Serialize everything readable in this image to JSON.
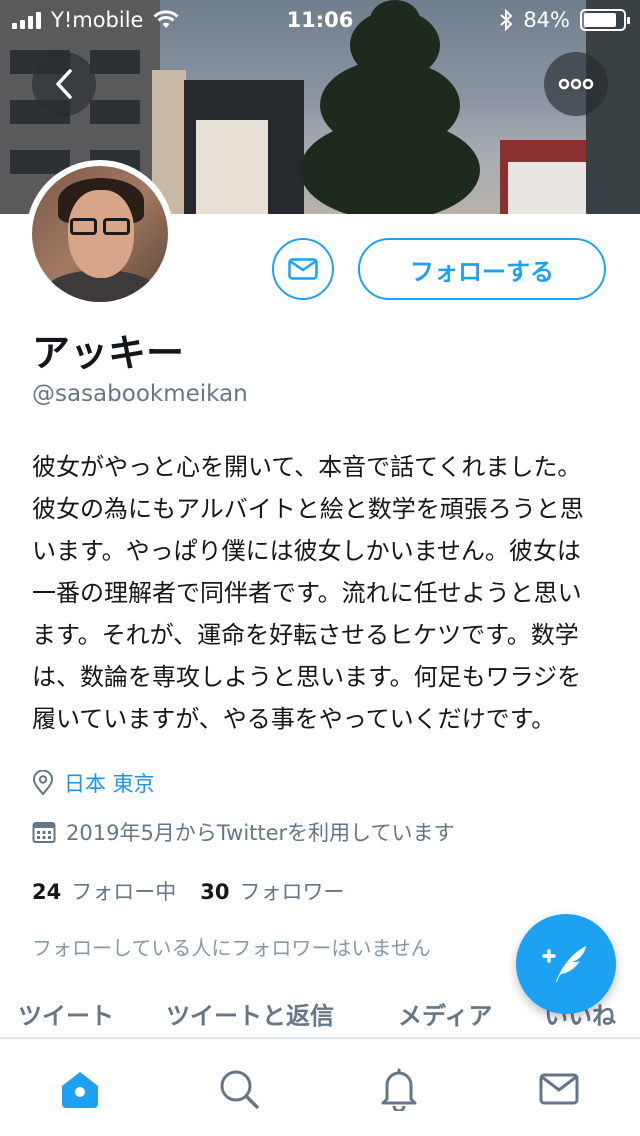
{
  "status_bar": {
    "carrier": "Y!mobile",
    "time": "11:06",
    "battery": "84%",
    "battery_level": 0.84
  },
  "profile": {
    "name": "アッキー",
    "handle": "@sasabookmeikan",
    "bio": "彼女がやっと心を開いて、本音で話てくれました。彼女の為にもアルバイトと絵と数学を頑張ろうと思います。やっぱり僕には彼女しかいません。彼女は一番の理解者で同伴者です。流れに任せようと思います。それが、運命を好転させるヒケツです。数学は、数論を専攻しようと思います。何足もワラジを履いていますが、やる事をやっていくだけです。",
    "location": "日本 東京",
    "joined": "2019年5月からTwitterを利用しています",
    "following_count": "24",
    "following_label": "フォロー中",
    "followers_count": "30",
    "followers_label": "フォロワー",
    "mutual_note": "フォローしている人にフォロワーはいません"
  },
  "actions": {
    "follow_label": "フォローする"
  },
  "tabs": [
    {
      "label": "ツイート",
      "active": true
    },
    {
      "label": "ツイートと返信",
      "active": false
    },
    {
      "label": "メディア",
      "active": false
    },
    {
      "label": "いいね",
      "active": false
    }
  ],
  "icons": {
    "back": "back-arrow-icon",
    "more": "more-options-icon",
    "message": "envelope-icon",
    "location": "location-pin-icon",
    "calendar": "calendar-icon",
    "compose": "compose-tweet-icon",
    "nav": [
      "home-icon",
      "search-icon",
      "notifications-icon",
      "messages-icon"
    ]
  },
  "colors": {
    "accent": "#1da1f2",
    "secondary_text": "#657786",
    "primary_text": "#14171a"
  }
}
